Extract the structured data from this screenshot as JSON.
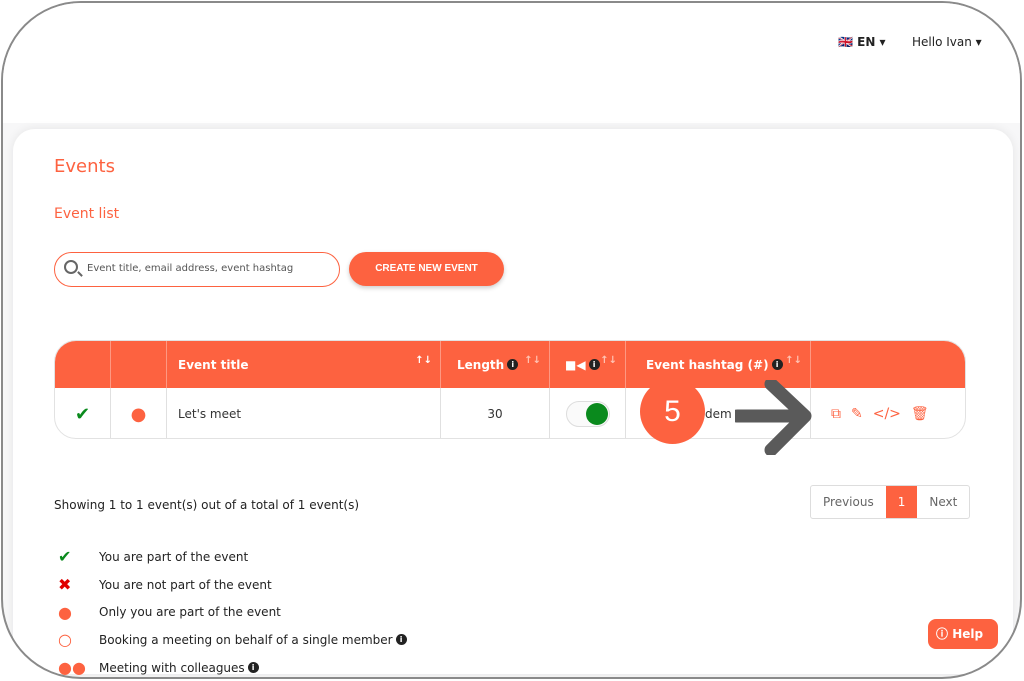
{
  "header": {
    "language": "EN",
    "language_flag": "uk-flag",
    "greeting": "Hello Ivan"
  },
  "page": {
    "title": "Events",
    "subtitle": "Event list"
  },
  "search": {
    "placeholder": "Event title, email address, event hashtag"
  },
  "create_button": "CREATE NEW EVENT",
  "table": {
    "headers": {
      "title": "Event title",
      "length": "Length",
      "video": "video-camera-icon",
      "hashtag": "Event hashtag (#)"
    },
    "rows": [
      {
        "status": "check-icon",
        "type": "single-person-icon",
        "title": "Let's meet",
        "length": "30",
        "video_enabled": true,
        "hashtag": "dem",
        "actions": [
          "copy-icon",
          "edit-icon",
          "embed-code-icon",
          "trash-icon"
        ]
      }
    ]
  },
  "annotation": {
    "step": "5"
  },
  "pagination": {
    "summary": "Showing 1 to 1 event(s) out of a total of 1 event(s)",
    "previous": "Previous",
    "current": "1",
    "next": "Next"
  },
  "legend": [
    {
      "icon": "check-icon",
      "label": "You are part of the event"
    },
    {
      "icon": "x-icon",
      "label": "You are not part of the event"
    },
    {
      "icon": "person-icon",
      "label": "Only you are part of the event"
    },
    {
      "icon": "person-outline-icon",
      "label": "Booking a meeting on behalf of a single member"
    },
    {
      "icon": "group-icon",
      "label": "Meeting with colleagues"
    }
  ],
  "help": "Help",
  "colors": {
    "accent": "#fd6240",
    "success": "#0a8a1d",
    "danger": "#e00000"
  }
}
